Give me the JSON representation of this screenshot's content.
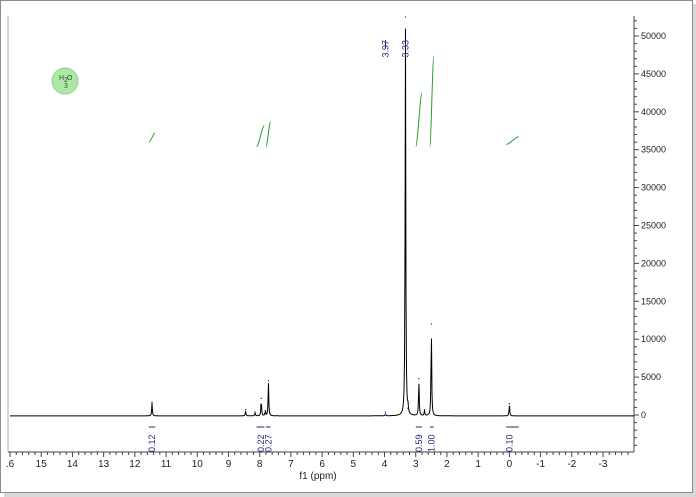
{
  "chart_data": {
    "type": "line",
    "title": "",
    "xlabel": "f1 (ppm)",
    "ylabel": "",
    "xlim": [
      16,
      -4
    ],
    "xdir": "reversed",
    "ylim": [
      -4500,
      53000
    ],
    "grid": false,
    "legend": "none",
    "xticks": [
      16,
      15,
      14,
      13,
      12,
      11,
      10,
      9,
      8,
      7,
      6,
      5,
      4,
      3,
      2,
      1,
      0,
      -1,
      -2,
      -3
    ],
    "xtick_labels": [
      ".6",
      "15",
      "14",
      "13",
      "12",
      "11",
      "10",
      "9",
      "8",
      "7",
      "6",
      "5",
      "4",
      "3",
      "2",
      "1",
      "0",
      "-1",
      "-2",
      "-3"
    ],
    "yticks": [
      0,
      5000,
      10000,
      15000,
      20000,
      25000,
      30000,
      35000,
      40000,
      45000,
      50000
    ],
    "ytick_labels": [
      "0",
      "5000",
      "10000",
      "15000",
      "20000",
      "25000",
      "30000",
      "35000",
      "40000",
      "45000",
      "50000"
    ],
    "series": [
      {
        "peaks": [
          {
            "ppm": 11.45,
            "intensity": 1700
          },
          {
            "ppm": 8.45,
            "intensity": 700
          },
          {
            "ppm": 8.15,
            "intensity": 400
          },
          {
            "ppm": 7.95,
            "intensity": 2200
          },
          {
            "ppm": 7.82,
            "intensity": 600
          },
          {
            "ppm": 7.72,
            "intensity": 4500
          },
          {
            "ppm": 3.97,
            "intensity": 300
          },
          {
            "ppm": 3.33,
            "intensity": 52500
          },
          {
            "ppm": 3.25,
            "intensity": 900
          },
          {
            "ppm": 2.9,
            "intensity": 4800
          },
          {
            "ppm": 2.72,
            "intensity": 700
          },
          {
            "ppm": 2.5,
            "intensity": 12000
          },
          {
            "ppm": 0.0,
            "intensity": 1500
          }
        ]
      }
    ],
    "peak_labels": [
      "3.97",
      "3.33"
    ],
    "peak_label_ppm": [
      3.97,
      3.33
    ],
    "integrals": [
      {
        "label": "0.12",
        "ppm": 11.45,
        "from": 11.55,
        "to": 11.35,
        "rise_from": 36000,
        "rise_to": 37200
      },
      {
        "label": "0.22",
        "ppm": 7.95,
        "from": 8.1,
        "to": 7.85,
        "rise_from": 35400,
        "rise_to": 38200
      },
      {
        "label": "0.27",
        "ppm": 7.72,
        "from": 7.8,
        "to": 7.65,
        "rise_from": 35400,
        "rise_to": 38700
      },
      {
        "label": "0.59",
        "ppm": 2.9,
        "from": 3.0,
        "to": 2.8,
        "rise_from": 35400,
        "rise_to": 42500
      },
      {
        "label": "1.00",
        "ppm": 2.5,
        "from": 2.55,
        "to": 2.42,
        "rise_from": 35400,
        "rise_to": 47400
      },
      {
        "label": "0.10",
        "ppm": 0.0,
        "from": 0.1,
        "to": -0.3,
        "rise_from": 35700,
        "rise_to": 36700
      }
    ],
    "badge": {
      "label_main": "H",
      "label_sub": "2",
      "label_end": "O",
      "label_below": "3",
      "color": "#aee8a8"
    },
    "colors": {
      "spectrum": "#000000",
      "integral": "#2e9a2e",
      "label": "#1f2a7a",
      "axis": "#444444"
    }
  }
}
